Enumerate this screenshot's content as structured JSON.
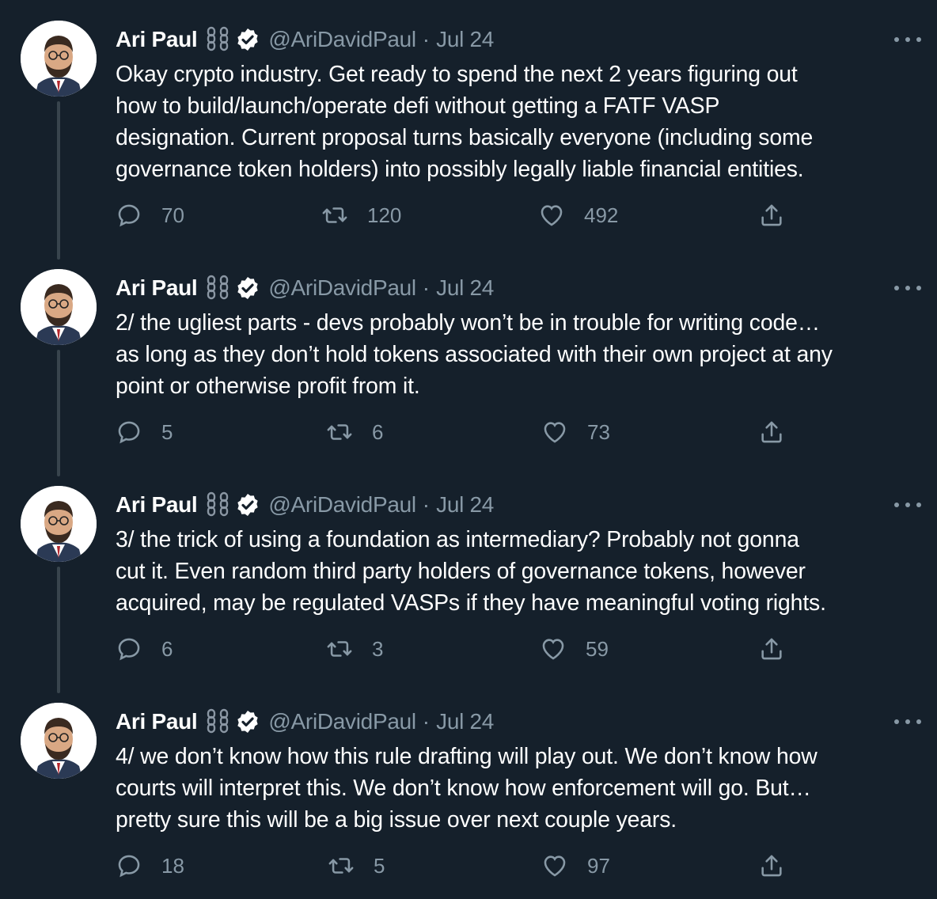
{
  "colors": {
    "background": "#15202b",
    "text": "#ffffff",
    "secondary": "#8899a6",
    "thread_line": "#38444d"
  },
  "icons": {
    "reply": "reply-icon",
    "retweet": "retweet-icon",
    "like": "heart-icon",
    "share": "share-icon",
    "verified": "verified-badge-icon",
    "more": "more-options-icon",
    "emoji": "chain-link-emoji-icon"
  },
  "tweets": [
    {
      "author": {
        "name": "Ari Paul",
        "handle": "@AriDavidPaul"
      },
      "separator": "·",
      "date": "Jul 24",
      "lines": [
        "Okay crypto industry.  Get ready to spend the next 2 years figuring out",
        "how to build/launch/operate defi without getting a FATF VASP",
        "designation.  Current proposal turns basically everyone (including some",
        "governance token holders) into possibly legally liable financial entities."
      ],
      "replies": "70",
      "retweets": "120",
      "likes": "492"
    },
    {
      "author": {
        "name": "Ari Paul",
        "handle": "@AriDavidPaul"
      },
      "separator": "·",
      "date": "Jul 24",
      "lines": [
        "2/ the ugliest parts - devs probably won’t be in trouble for writing code…",
        "as long as they don’t hold tokens associated with their own project at any",
        "point or otherwise profit from it."
      ],
      "replies": "5",
      "retweets": "6",
      "likes": "73"
    },
    {
      "author": {
        "name": "Ari Paul",
        "handle": "@AriDavidPaul"
      },
      "separator": "·",
      "date": "Jul 24",
      "lines": [
        "3/ the trick of using a foundation as intermediary?  Probably not gonna",
        "cut it.  Even random third party holders of governance tokens, however",
        "acquired, may be regulated VASPs if they have meaningful voting rights."
      ],
      "replies": "6",
      "retweets": "3",
      "likes": "59"
    },
    {
      "author": {
        "name": "Ari Paul",
        "handle": "@AriDavidPaul"
      },
      "separator": "·",
      "date": "Jul 24",
      "lines": [
        "4/ we don’t know how this rule drafting will play out.  We don’t know how",
        "courts will interpret this.  We don’t know how enforcement will go.  But…",
        "pretty sure this will be a big issue over next couple years."
      ],
      "replies": "18",
      "retweets": "5",
      "likes": "97"
    }
  ]
}
